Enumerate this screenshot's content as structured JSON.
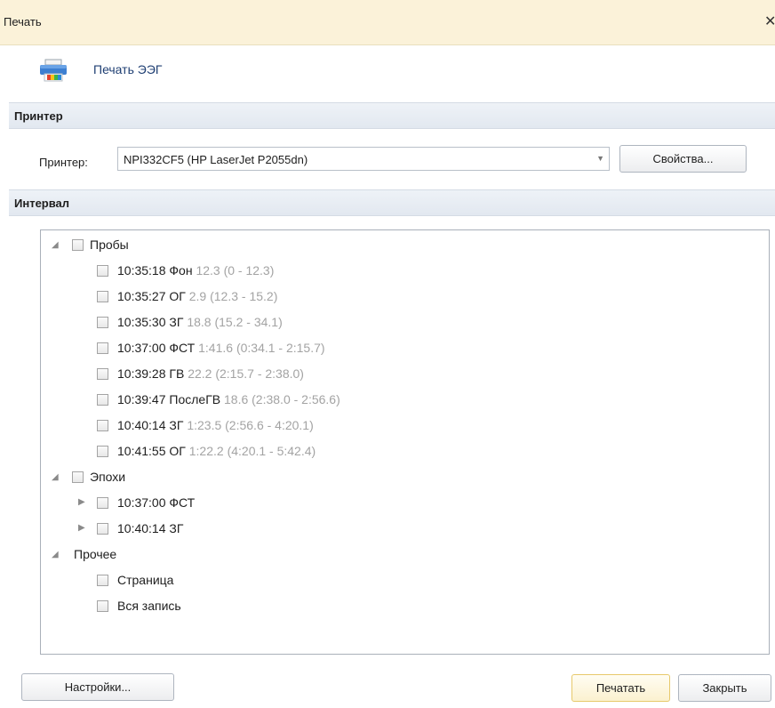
{
  "window": {
    "title": "Печать",
    "close_glyph": "✕"
  },
  "header": {
    "title": "Печать ЭЭГ",
    "icon": "printer-icon"
  },
  "printer_section": {
    "title": "Принтер",
    "label": "Принтер:",
    "value": "NPI332CF5 (HP LaserJet P2055dn)",
    "properties_button": "Свойства..."
  },
  "interval_section": {
    "title": "Интервал"
  },
  "tree": {
    "probes": {
      "label": "Пробы",
      "items": [
        {
          "label": "10:35:18 Фон",
          "detail": "12.3 (0 - 12.3)"
        },
        {
          "label": "10:35:27 ОГ",
          "detail": "2.9 (12.3 - 15.2)"
        },
        {
          "label": "10:35:30 ЗГ",
          "detail": "18.8 (15.2 - 34.1)"
        },
        {
          "label": "10:37:00 ФСТ",
          "detail": "1:41.6 (0:34.1 - 2:15.7)"
        },
        {
          "label": "10:39:28 ГВ",
          "detail": "22.2 (2:15.7 - 2:38.0)"
        },
        {
          "label": "10:39:47 ПослеГВ",
          "detail": "18.6 (2:38.0 - 2:56.6)"
        },
        {
          "label": "10:40:14 ЗГ",
          "detail": "1:23.5 (2:56.6 - 4:20.1)"
        },
        {
          "label": "10:41:55 ОГ",
          "detail": "1:22.2 (4:20.1 - 5:42.4)"
        }
      ]
    },
    "epochs": {
      "label": "Эпохи",
      "items": [
        {
          "label": "10:37:00 ФСТ"
        },
        {
          "label": "10:40:14 ЗГ"
        }
      ]
    },
    "other": {
      "label": "Прочее",
      "items": [
        {
          "label": "Страница"
        },
        {
          "label": "Вся запись"
        }
      ]
    }
  },
  "footer": {
    "settings_button": "Настройки...",
    "print_button": "Печатать",
    "close_button": "Закрыть"
  }
}
